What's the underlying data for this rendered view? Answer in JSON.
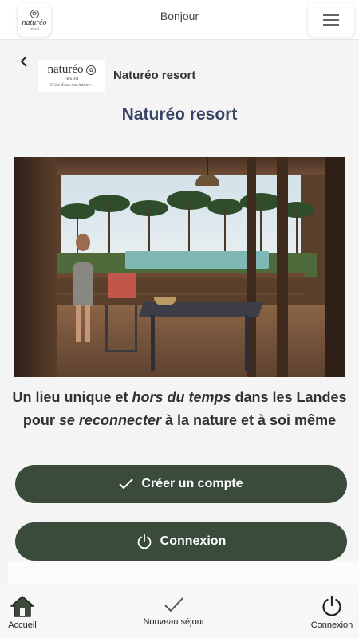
{
  "header": {
    "greeting": "Bonjour",
    "logo": {
      "word": "naturéo",
      "sub": "resort"
    }
  },
  "resort": {
    "logo_word": "naturéo",
    "logo_sub": "resort",
    "logo_tagline": "C'est doux ma nature !",
    "name": "Naturéo resort",
    "title": "Naturéo resort"
  },
  "tagline": {
    "part1": "Un lieu unique et ",
    "emph1": "hors du temps",
    "part2": " dans les Landes pour ",
    "emph2": "se reconnecter",
    "part3": " à la nature et à soi même"
  },
  "buttons": {
    "create_account": "Créer un compte",
    "login": "Connexion"
  },
  "bottom_nav": {
    "home": "Accueil",
    "new_stay": "Nouveau séjour",
    "login": "Connexion"
  },
  "colors": {
    "primary_button": "#3a4a3b",
    "title": "#3a4466",
    "background": "#f3f4f3"
  },
  "icons": [
    "menu-icon",
    "back-chevron-icon",
    "checkmark-icon",
    "power-icon",
    "home-icon"
  ]
}
